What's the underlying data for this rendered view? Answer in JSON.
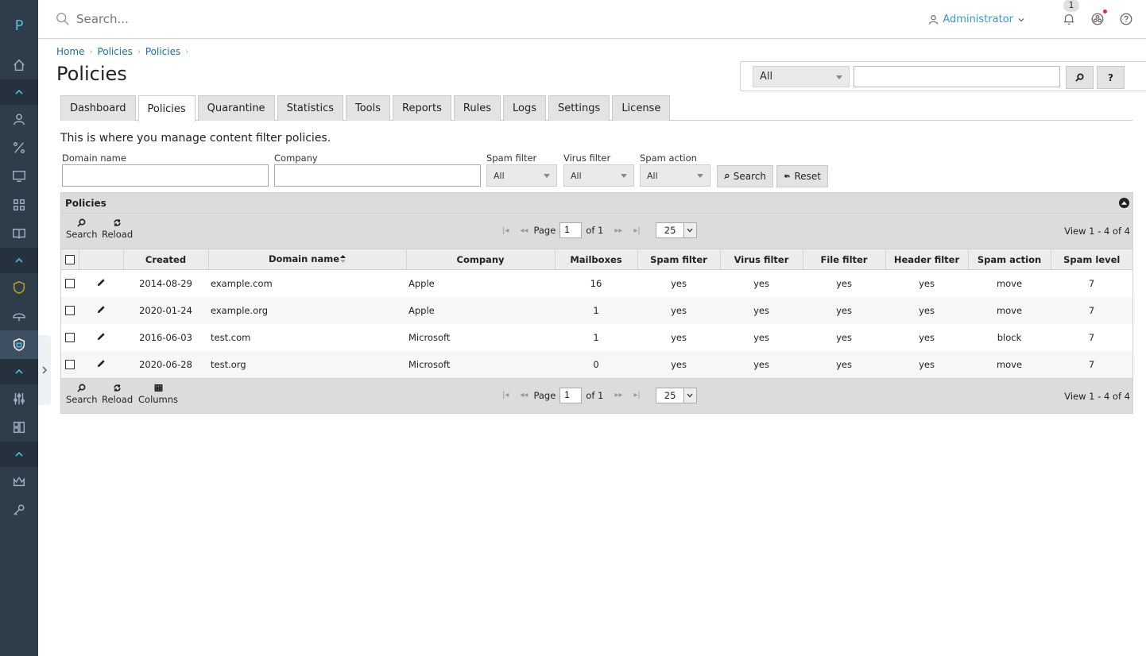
{
  "app": {
    "logo_letter": "P"
  },
  "topbar": {
    "search_placeholder": "Search...",
    "user_label": "Administrator",
    "notification_count": "1"
  },
  "breadcrumb": [
    "Home",
    "Policies",
    "Policies"
  ],
  "page_title": "Policies",
  "quick_search": {
    "scope_value": "All",
    "help_label": "?"
  },
  "tabs": [
    {
      "label": "Dashboard",
      "active": false
    },
    {
      "label": "Policies",
      "active": true
    },
    {
      "label": "Quarantine",
      "active": false
    },
    {
      "label": "Statistics",
      "active": false
    },
    {
      "label": "Tools",
      "active": false
    },
    {
      "label": "Reports",
      "active": false
    },
    {
      "label": "Rules",
      "active": false
    },
    {
      "label": "Logs",
      "active": false
    },
    {
      "label": "Settings",
      "active": false
    },
    {
      "label": "License",
      "active": false
    }
  ],
  "description": "This is where you manage content filter policies.",
  "filters": {
    "domain_label": "Domain name",
    "company_label": "Company",
    "spam_filter_label": "Spam filter",
    "spam_filter_value": "All",
    "virus_filter_label": "Virus filter",
    "virus_filter_value": "All",
    "spam_action_label": "Spam action",
    "spam_action_value": "All",
    "search_button": "Search",
    "reset_button": "Reset"
  },
  "grid": {
    "caption": "Policies",
    "toolbar": {
      "search": "Search",
      "reload": "Reload",
      "columns": "Columns"
    },
    "pager": {
      "page_label": "Page",
      "page_value": "1",
      "of_label": "of 1",
      "page_size": "25",
      "view_text": "View 1 - 4 of 4"
    },
    "columns": [
      "Created",
      "Domain name",
      "Company",
      "Mailboxes",
      "Spam filter",
      "Virus filter",
      "File filter",
      "Header filter",
      "Spam action",
      "Spam level"
    ],
    "rows": [
      {
        "created": "2014-08-29",
        "domain": "example.com",
        "company": "Apple",
        "mailboxes": "16",
        "spam": "yes",
        "virus": "yes",
        "file": "yes",
        "header": "yes",
        "action": "move",
        "level": "7"
      },
      {
        "created": "2020-01-24",
        "domain": "example.org",
        "company": "Apple",
        "mailboxes": "1",
        "spam": "yes",
        "virus": "yes",
        "file": "yes",
        "header": "yes",
        "action": "move",
        "level": "7"
      },
      {
        "created": "2016-06-03",
        "domain": "test.com",
        "company": "Microsoft",
        "mailboxes": "1",
        "spam": "yes",
        "virus": "yes",
        "file": "yes",
        "header": "yes",
        "action": "block",
        "level": "7"
      },
      {
        "created": "2020-06-28",
        "domain": "test.org",
        "company": "Microsoft",
        "mailboxes": "0",
        "spam": "yes",
        "virus": "yes",
        "file": "yes",
        "header": "yes",
        "action": "move",
        "level": "7"
      }
    ]
  },
  "colors": {
    "sidebar": "#2f3d4a",
    "accent": "#2b9fd3",
    "yes": "#3f8a3f"
  }
}
